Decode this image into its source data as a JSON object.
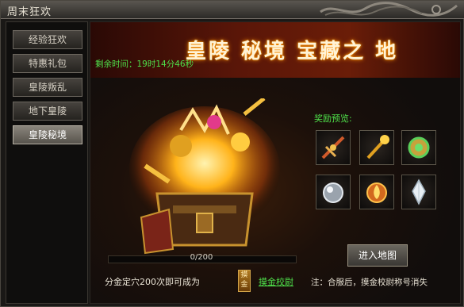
{
  "window": {
    "title": "周末狂欢"
  },
  "sidebar": {
    "items": [
      {
        "label": "经验狂欢",
        "active": false
      },
      {
        "label": "特惠礼包",
        "active": false
      },
      {
        "label": "皇陵叛乱",
        "active": false
      },
      {
        "label": "地下皇陵",
        "active": false
      },
      {
        "label": "皇陵秘境",
        "active": true
      }
    ]
  },
  "banner": {
    "title": "皇陵 秘境 宝藏之 地"
  },
  "countdown": "剩余时间：19时14分46秒",
  "rewards": {
    "label": "奖励预览:",
    "items": [
      {
        "icon": "crossbow-icon"
      },
      {
        "icon": "golden-staff-icon"
      },
      {
        "icon": "jade-amulet-icon"
      },
      {
        "icon": "silver-orb-icon"
      },
      {
        "icon": "fire-medallion-icon"
      },
      {
        "icon": "crystal-shard-icon"
      }
    ]
  },
  "progress": {
    "text": "0/200",
    "value": 0
  },
  "enter_button": "进入地图",
  "bottom": {
    "text": "分金定穴200次即可成为",
    "badge": "摸金",
    "title_link": "摸金校尉",
    "note": "注：合服后，摸金校尉称号消失"
  },
  "colors": {
    "accent_green": "#4fe04a",
    "gold": "#caa34b",
    "banner_red": "#5a1608"
  }
}
